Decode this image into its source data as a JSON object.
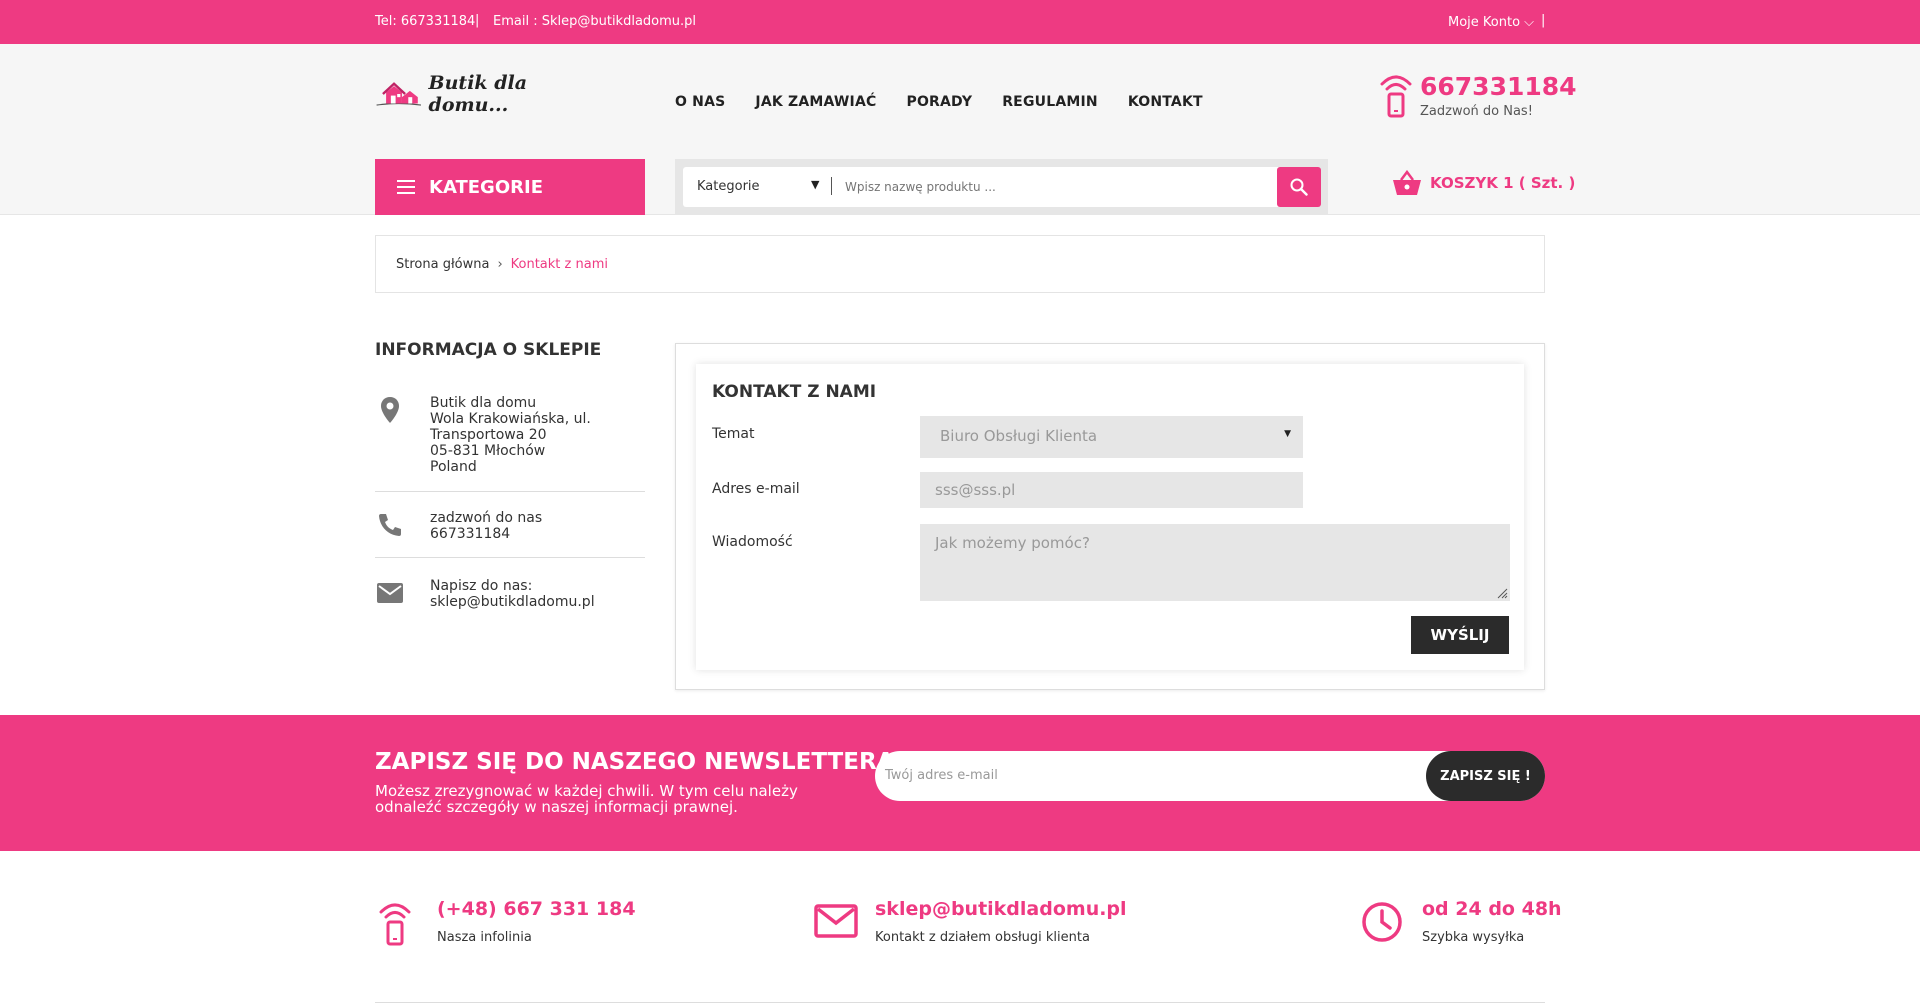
{
  "topbar": {
    "tel": "Tel: 667331184",
    "separator": "|",
    "email": "Email : Sklep@butikdladomu.pl",
    "account": "Moje Konto ⌵"
  },
  "header": {
    "logo_text": "Butik dla domu...",
    "nav": [
      "O NAS",
      "JAK ZAMAWIAĆ",
      "PORADY",
      "REGULAMIN",
      "KONTAKT"
    ],
    "phone": "667331184",
    "phone_sub": "Zadzwoń do Nas!",
    "categories_button": "KATEGORIE",
    "search": {
      "category": "Kategorie",
      "placeholder": "Wpisz nazwę produktu ..."
    },
    "cart": "KOSZYK 1 ( Szt. )"
  },
  "breadcrumb": {
    "home": "Strona główna",
    "current": "Kontakt z nami"
  },
  "sidebar": {
    "title": "INFORMACJA O SKLEPIE",
    "address": [
      "Butik dla domu",
      "Wola Krakowiańska, ul.",
      "Transportowa 20",
      "05-831 Młochów",
      "Poland"
    ],
    "call_label": "zadzwoń do nas",
    "call_number": "667331184",
    "mail_label": "Napisz do nas:",
    "mail_address": "sklep@butikdladomu.pl"
  },
  "contact": {
    "title": "KONTAKT Z NAMI",
    "subject_label": "Temat",
    "subject_value": "Biuro Obsługi Klienta",
    "email_label": "Adres e-mail",
    "email_placeholder": "sss@sss.pl",
    "message_label": "Wiadomość",
    "message_placeholder": "Jak możemy pomóc?",
    "send_button": "WYŚLIJ"
  },
  "newsletter": {
    "title": "ZAPISZ SIĘ DO NASZEGO NEWSLETTERA",
    "description": "Możesz zrezygnować w każdej chwili. W tym celu należy odnaleźć szczegóły w naszej informacji prawnej.",
    "placeholder": "Twój adres e-mail",
    "button": "ZAPISZ SIĘ !"
  },
  "footer_info": [
    {
      "big": "(+48) 667 331 184",
      "small": "Nasza infolinia",
      "icon": "phone-icon"
    },
    {
      "big": "sklep@butikdladomu.pl",
      "small": "Kontakt z działem obsługi klienta",
      "icon": "mail-icon"
    },
    {
      "big": "od 24 do 48h",
      "small": "Szybka wysyłka",
      "icon": "clock-icon"
    }
  ],
  "colors": {
    "brand": "#ee3a82",
    "dark": "#2b2b2b",
    "header_bg": "#f6f6f6"
  }
}
